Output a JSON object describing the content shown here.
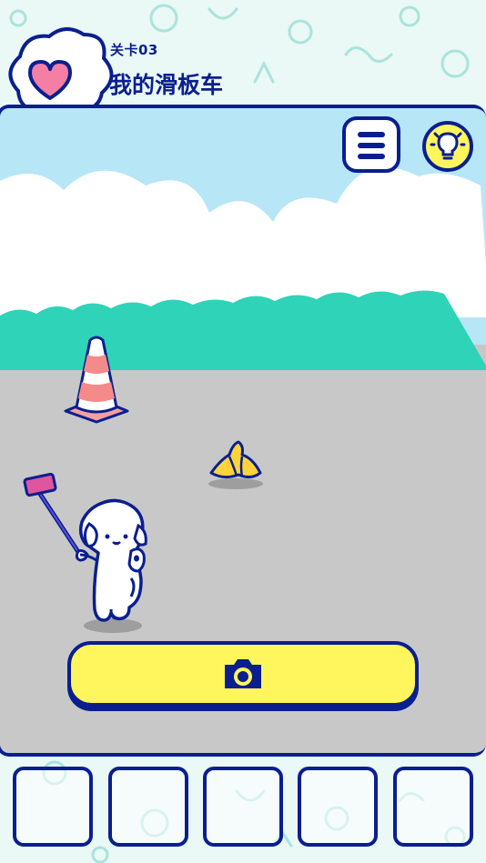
{
  "header": {
    "level_label": "关卡03",
    "title": "我的滑板车"
  },
  "icons": {
    "thought": "heart-icon",
    "menu": "menu-icon",
    "hint": "lightbulb-icon",
    "camera": "camera-icon"
  },
  "scene": {
    "objects": [
      "traffic-cone",
      "banana-peel",
      "dog-with-selfie-stick"
    ]
  },
  "inventory": {
    "slots": [
      "",
      "",
      "",
      "",
      ""
    ]
  },
  "colors": {
    "outline": "#0a1f8f",
    "sky": "#b7e6f6",
    "bushes": "#2fd3b8",
    "ground": "#c8c8c8",
    "camera_button": "#fff55c",
    "hint_button": "#fff55c",
    "heart": "#f47ea4",
    "background": "#eaf8f6"
  }
}
